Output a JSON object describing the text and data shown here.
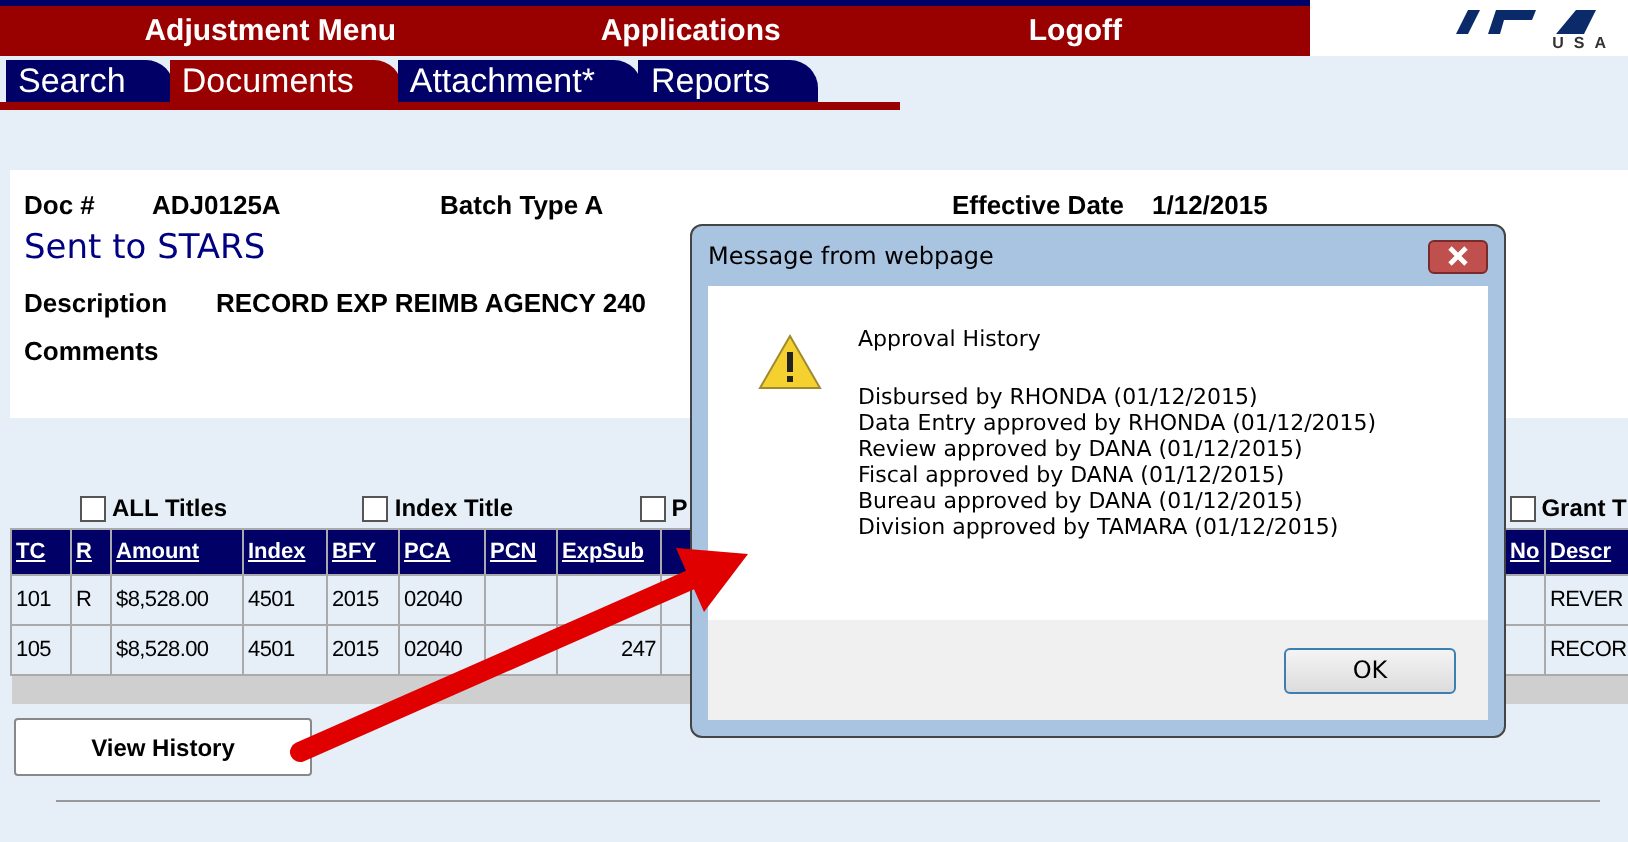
{
  "top_menu": [
    "Adjustment Menu",
    "Applications",
    "Logoff"
  ],
  "logo_text": "USA",
  "tabs": [
    {
      "label": "Search",
      "selected": false
    },
    {
      "label": "Documents",
      "selected": true
    },
    {
      "label": "Attachment*",
      "selected": false
    },
    {
      "label": "Reports",
      "selected": false
    }
  ],
  "document": {
    "doc_label": "Doc #",
    "doc_value": "ADJ0125A",
    "batch_label": "Batch Type A",
    "effective_label": "Effective Date",
    "effective_value": "1/12/2015",
    "status": "Sent to STARS",
    "description_label": "Description",
    "description_value": "RECORD EXP REIMB AGENCY 240",
    "comments_label": "Comments"
  },
  "title_options": [
    {
      "label": "ALL Titles",
      "checked": false
    },
    {
      "label": "Index Title",
      "checked": false
    },
    {
      "label": "P",
      "checked": false
    },
    {
      "label": "Grant T",
      "checked": false
    }
  ],
  "table": {
    "columns": [
      "TC",
      "R",
      "Amount",
      "Index",
      "BFY",
      "PCA",
      "PCN",
      "ExpSub",
      "No",
      "Descr"
    ],
    "rows": [
      [
        "101",
        "R",
        "$8,528.00",
        "4501",
        "2015",
        "02040",
        "",
        "",
        "",
        "REVER"
      ],
      [
        "105",
        "",
        "$8,528.00",
        "4501",
        "2015",
        "02040",
        "",
        "247",
        "",
        "RECOR"
      ]
    ]
  },
  "view_history_button": "View History",
  "dialog": {
    "title": "Message from webpage",
    "heading": "Approval History",
    "lines": [
      "Disbursed by RHONDA (01/12/2015)",
      "Data Entry approved by RHONDA (01/12/2015)",
      "Review approved by DANA (01/12/2015)",
      "Fiscal approved by DANA (01/12/2015)",
      "Bureau approved by DANA (01/12/2015)",
      "Division approved by TAMARA (01/12/2015)"
    ],
    "ok_button": "OK"
  }
}
